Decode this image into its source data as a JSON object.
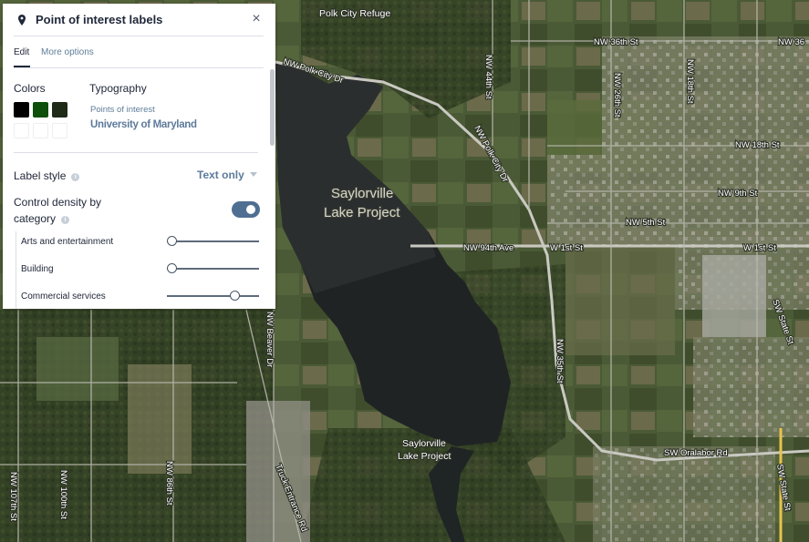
{
  "panel": {
    "title": "Point of interest labels",
    "close_glyph": "×",
    "tabs": [
      {
        "label": "Edit",
        "active": true
      },
      {
        "label": "More options",
        "active": false
      }
    ],
    "colors_heading": "Colors",
    "color_swatches": [
      "#000000",
      "#0f4f0c",
      "#1f2a17",
      "",
      "",
      ""
    ],
    "typography_heading": "Typography",
    "typography_preview_small": "Points of interest",
    "typography_preview_large": "University of Maryland",
    "label_style_label": "Label style",
    "label_style_value": "Text only",
    "density_label_line1": "Control density by",
    "density_label_line2": "category",
    "density_enabled": true,
    "categories": [
      {
        "label": "Arts and entertainment",
        "level": 0.0
      },
      {
        "label": "Building",
        "level": 0.0
      },
      {
        "label": "Commercial services",
        "level": 0.73
      }
    ],
    "accent_color": "#4f6f92"
  },
  "map": {
    "labels": {
      "polk_city_refuge": "Polk City Refuge",
      "nw_polk_city_dr_1": "NW Polk City Dr",
      "nw_polk_city_dr_2": "NW Polk City Dr",
      "nw_44th_st": "NW 44th St",
      "nw_36th_st_1": "NW 36th St",
      "nw_36th_st_2": "NW 36",
      "nw_26th_st": "NW 26th St",
      "nw_18th_st_v": "NW 18th St",
      "nw_18th_st_h": "NW 18th St",
      "nw_9th_st": "NW 9th St",
      "nw_5th_st": "NW 5th St",
      "nw_94th_ave": "NW 94th Ave",
      "w_1st_st_1": "W 1st St",
      "w_1st_st_2": "W 1st St",
      "saylorville_lake_line1": "Saylorville",
      "saylorville_lake_line2": "Lake Project",
      "saylorville_small_line1": "Saylorville",
      "saylorville_small_line2": "Lake Project",
      "nw_35th_st": "NW 35th St",
      "nw_beaver_dr": "NW Beaver Dr",
      "nw_86th_st": "NW 86th St",
      "nw_100th_st": "NW 100th St",
      "nw_107th_st": "NW 107th St",
      "truck_entrance_rd": "Truck Entrance Rd",
      "sw_oralabor_rd": "SW Oralabor Rd",
      "sw_state_st_1": "SW State St",
      "sw_state_st_2": "SW State St"
    }
  }
}
